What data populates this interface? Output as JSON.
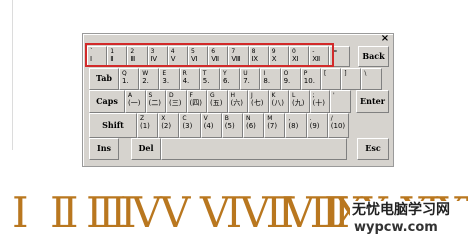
{
  "close_glyph": "×",
  "row1": [
    {
      "top": "`",
      "bottom": "Ⅰ"
    },
    {
      "top": "1",
      "bottom": "Ⅱ"
    },
    {
      "top": "2",
      "bottom": "Ⅲ"
    },
    {
      "top": "3",
      "bottom": "Ⅳ"
    },
    {
      "top": "4",
      "bottom": "Ⅴ"
    },
    {
      "top": "5",
      "bottom": "Ⅵ"
    },
    {
      "top": "6",
      "bottom": "Ⅶ"
    },
    {
      "top": "7",
      "bottom": "Ⅷ"
    },
    {
      "top": "8",
      "bottom": "Ⅸ"
    },
    {
      "top": "9",
      "bottom": "Ⅹ"
    },
    {
      "top": "0",
      "bottom": "Ⅺ"
    },
    {
      "top": "-",
      "bottom": "Ⅻ"
    },
    {
      "top": "=",
      "bottom": ""
    }
  ],
  "row2": [
    {
      "top": "Q",
      "bottom": "1."
    },
    {
      "top": "W",
      "bottom": "2."
    },
    {
      "top": "E",
      "bottom": "3."
    },
    {
      "top": "R",
      "bottom": "4."
    },
    {
      "top": "T",
      "bottom": "5."
    },
    {
      "top": "Y",
      "bottom": "6."
    },
    {
      "top": "U",
      "bottom": "7."
    },
    {
      "top": "I",
      "bottom": "8."
    },
    {
      "top": "O",
      "bottom": "9."
    },
    {
      "top": "P",
      "bottom": "10."
    },
    {
      "top": "[",
      "bottom": ""
    },
    {
      "top": "]",
      "bottom": ""
    },
    {
      "top": "\\",
      "bottom": ""
    }
  ],
  "row3": [
    {
      "top": "A",
      "bottom": "(一)"
    },
    {
      "top": "S",
      "bottom": "(二)"
    },
    {
      "top": "D",
      "bottom": "(三)"
    },
    {
      "top": "F",
      "bottom": "(四)"
    },
    {
      "top": "G",
      "bottom": "(五)"
    },
    {
      "top": "H",
      "bottom": "(六)"
    },
    {
      "top": "J",
      "bottom": "(七)"
    },
    {
      "top": "K",
      "bottom": "(八)"
    },
    {
      "top": "L",
      "bottom": "(九)"
    },
    {
      "top": ";",
      "bottom": "(十)"
    },
    {
      "top": "'",
      "bottom": ""
    }
  ],
  "row4": [
    {
      "top": "Z",
      "bottom": "(1)"
    },
    {
      "top": "X",
      "bottom": "(2)"
    },
    {
      "top": "C",
      "bottom": "(3)"
    },
    {
      "top": "V",
      "bottom": "(4)"
    },
    {
      "top": "B",
      "bottom": "(5)"
    },
    {
      "top": "N",
      "bottom": "(6)"
    },
    {
      "top": "M",
      "bottom": "(7)"
    },
    {
      "top": ",",
      "bottom": "(8)"
    },
    {
      "top": ".",
      "bottom": "(9)"
    },
    {
      "top": "/",
      "bottom": "(10)"
    }
  ],
  "keys": {
    "back": "Back",
    "tab": "Tab",
    "caps": "Caps",
    "enter": "Enter",
    "shift": "Shift",
    "ins": "Ins",
    "del": "Del",
    "esc": "Esc"
  },
  "numerals": [
    "Ⅰ",
    "Ⅱ",
    "Ⅲ",
    "Ⅳ",
    "Ⅴ",
    "Ⅵ",
    "Ⅶ",
    "Ⅷ",
    "Ⅸ",
    "Ⅹ",
    "Ⅺ",
    "Ⅻ"
  ],
  "watermark": {
    "line1": "无忧电脑学习网",
    "line2": "wypcw.com"
  },
  "colors": {
    "highlight": "#d22a2a",
    "numeral": "#b9771f",
    "panel": "#d6d3ce"
  }
}
